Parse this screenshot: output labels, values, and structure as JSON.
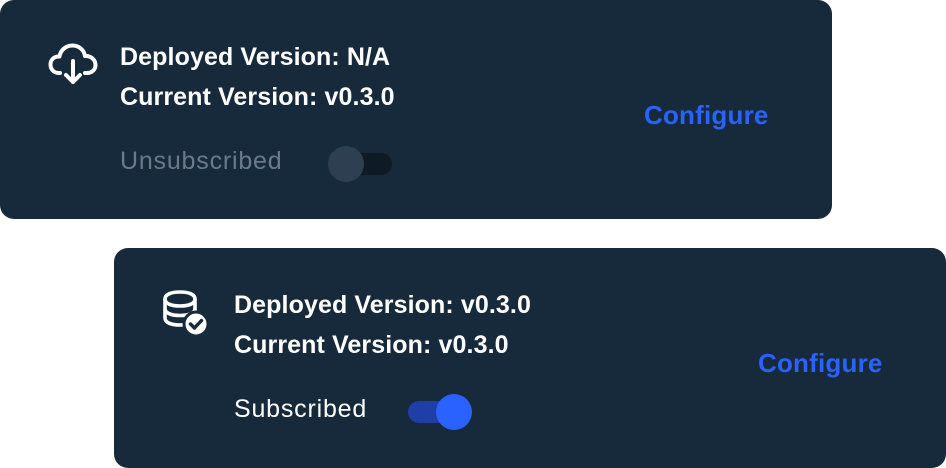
{
  "cards": [
    {
      "icon": "cloud-download-icon",
      "deployed_version": "Deployed Version: N/A",
      "current_version": "Current Version: v0.3.0",
      "subscription_label": "Unsubscribed",
      "subscribed": false,
      "configure_label": "Configure"
    },
    {
      "icon": "database-check-icon",
      "deployed_version": "Deployed Version: v0.3.0",
      "current_version": "Current Version: v0.3.0",
      "subscription_label": "Subscribed",
      "subscribed": true,
      "configure_label": "Configure"
    }
  ],
  "colors": {
    "card_background": "#162a3b",
    "accent": "#2962ff",
    "toggle_on_track": "#1f3ea8",
    "toggle_off_knob": "#2d3f50",
    "muted_text": "#6b7a88",
    "text": "#ffffff"
  }
}
